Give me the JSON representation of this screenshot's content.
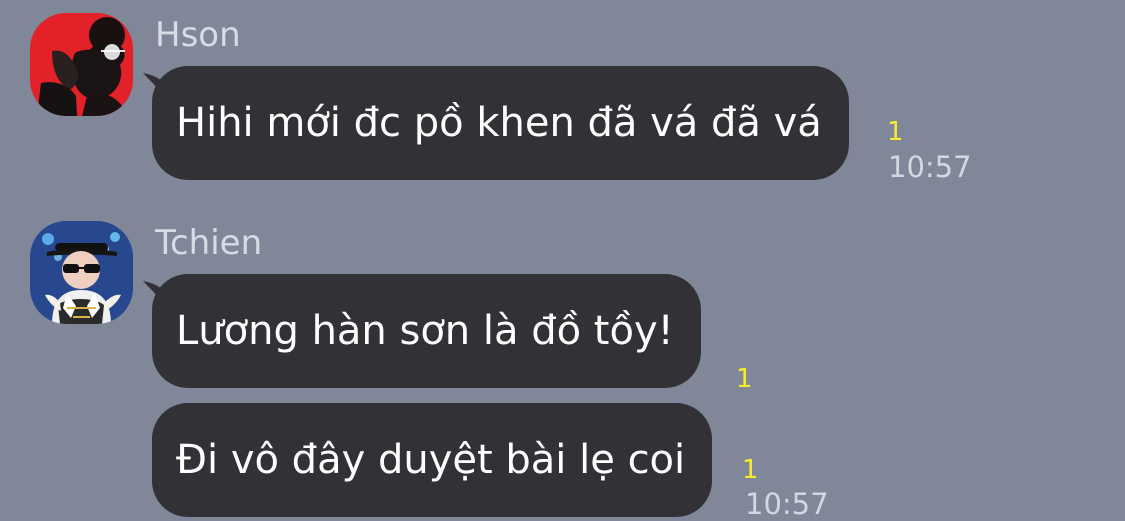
{
  "chat": {
    "messages": [
      {
        "sender": "Hson",
        "avatar": "red-portrait-avatar",
        "text": "Hihi mới đc pồ khen đã vá đã vá",
        "read_count": "1",
        "time": "10:57"
      },
      {
        "sender": "Tchien",
        "avatar": "blue-stage-avatar",
        "bubbles": [
          {
            "text": "Lương hàn sơn là đồ tồy!",
            "read_count": "1"
          },
          {
            "text": "Đi vô đây duyệt bài lẹ coi",
            "read_count": "1",
            "time": "10:57"
          }
        ]
      }
    ]
  }
}
